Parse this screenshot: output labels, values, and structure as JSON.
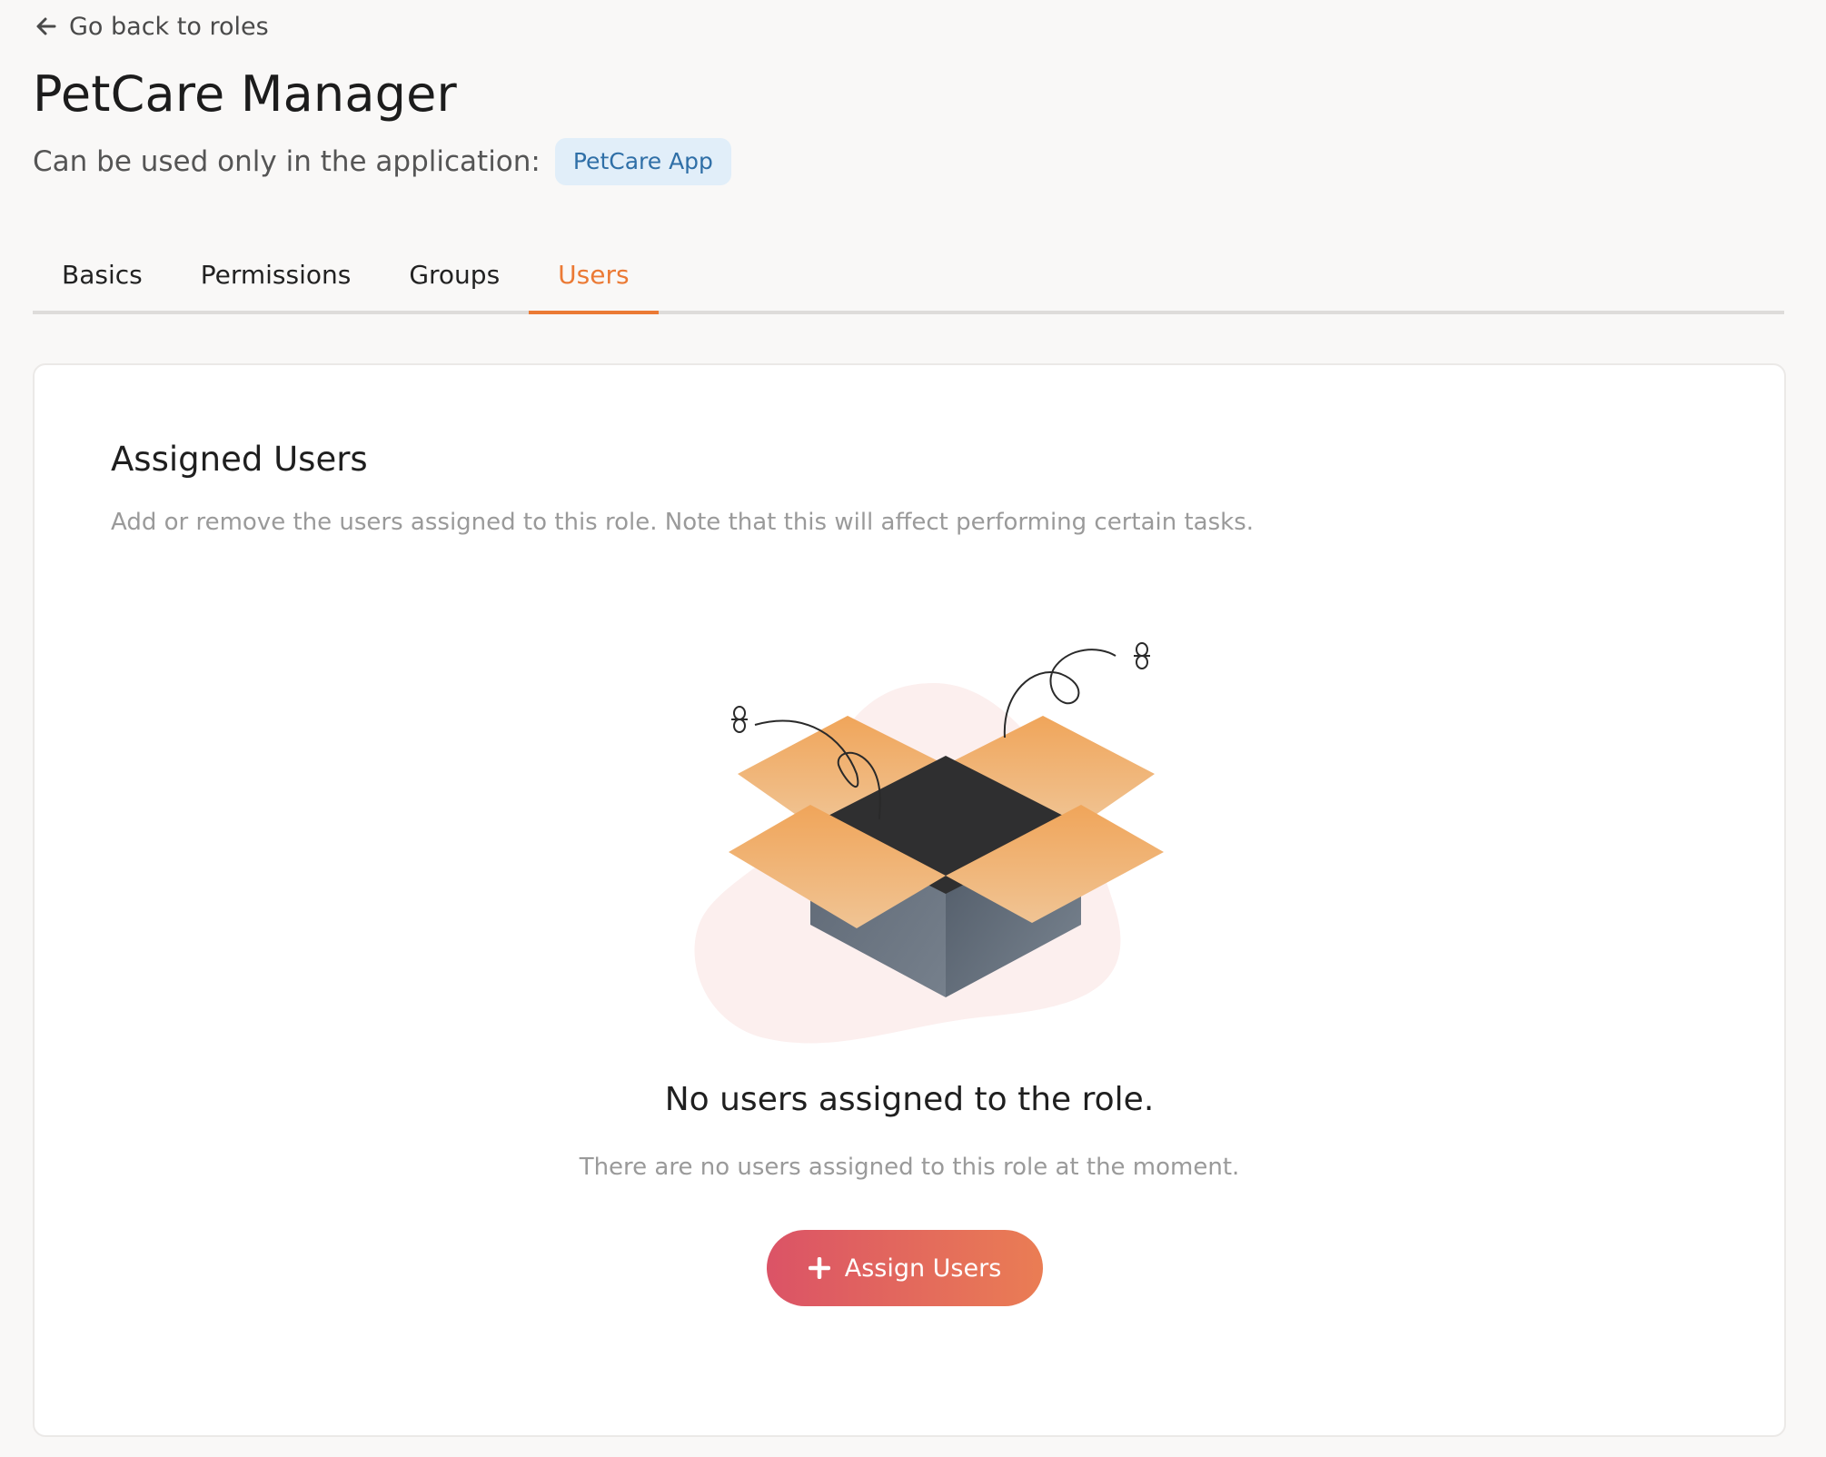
{
  "nav": {
    "back_label": "Go back to roles",
    "back_icon": "arrow-left-icon"
  },
  "role": {
    "title": "PetCare Manager",
    "scope_text": "Can be used only in the application:",
    "application_chip": "PetCare App"
  },
  "tabs": [
    {
      "label": "Basics",
      "active": false
    },
    {
      "label": "Permissions",
      "active": false
    },
    {
      "label": "Groups",
      "active": false
    },
    {
      "label": "Users",
      "active": true
    }
  ],
  "assigned_users": {
    "heading": "Assigned Users",
    "description": "Add or remove the users assigned to this role. Note that this will affect performing certain tasks.",
    "empty_state": {
      "illustration": "empty-open-box-illustration",
      "title": "No users assigned to the role.",
      "message": "There are no users assigned to this role at the moment."
    },
    "assign_button_label": "Assign Users",
    "assign_button_icon": "plus-icon"
  },
  "colors": {
    "accent": "#eb7a35",
    "chip_bg": "#e1eef9",
    "chip_text": "#2f6fa7",
    "button_gradient_start": "#db5366",
    "button_gradient_end": "#ea7d54"
  }
}
